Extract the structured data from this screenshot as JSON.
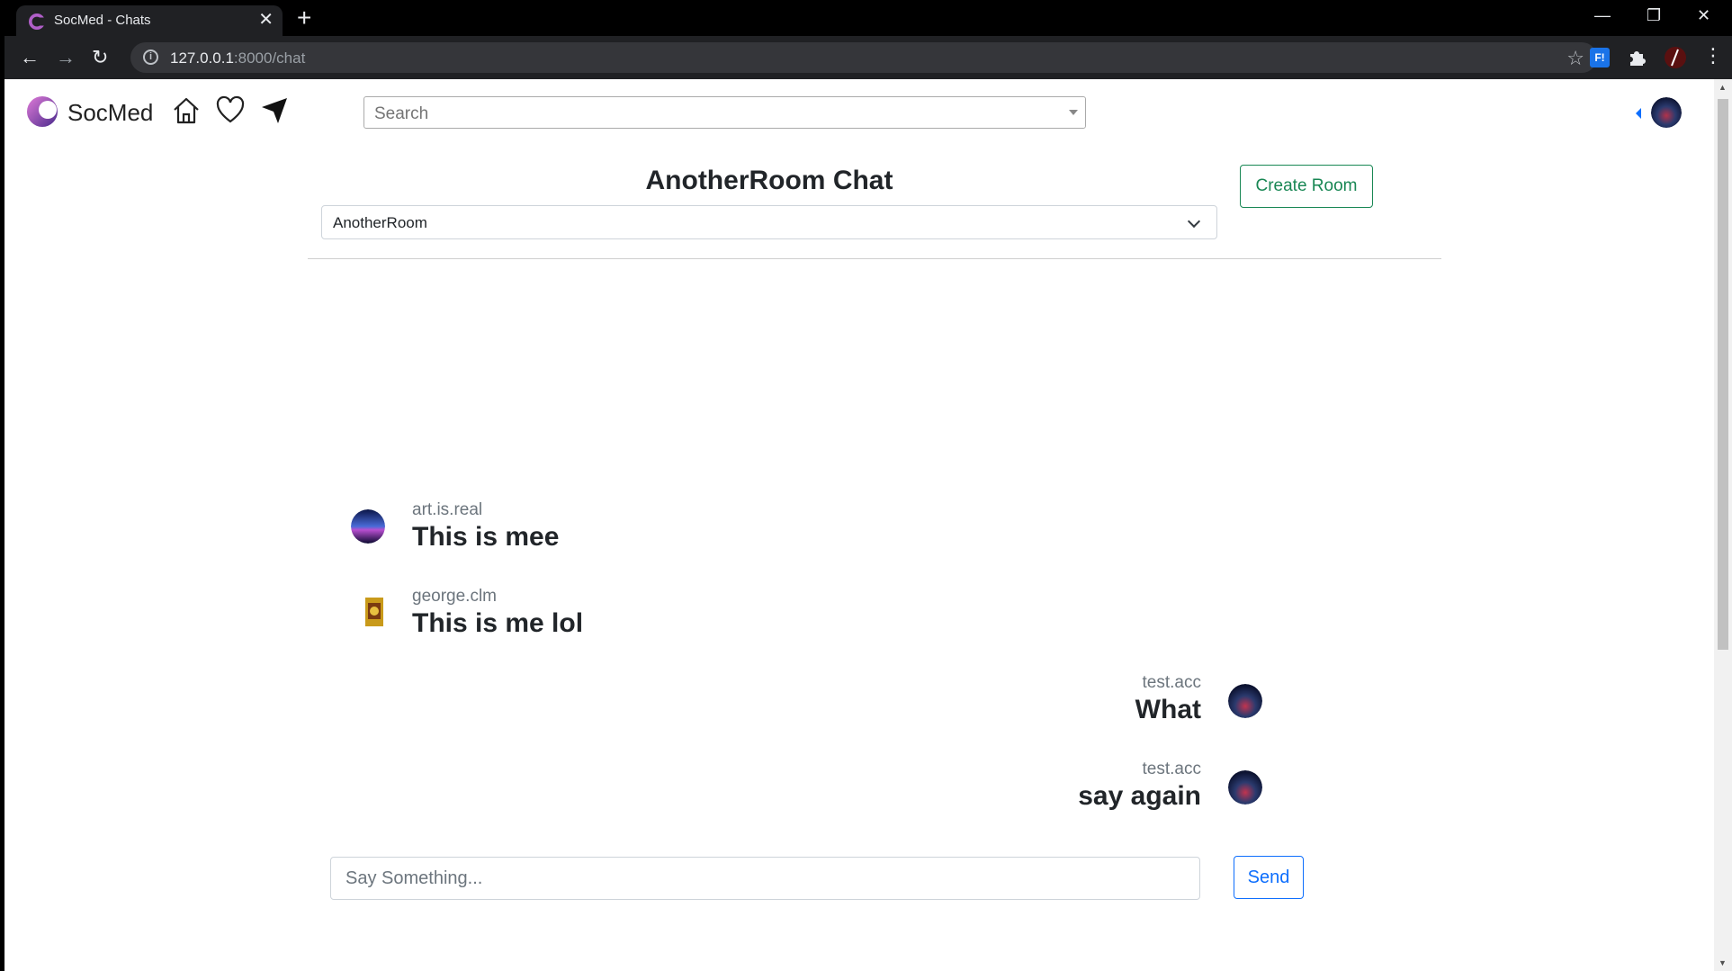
{
  "browser": {
    "tab_title": "SocMed - Chats",
    "tab_close": "✕",
    "new_tab": "+",
    "url_host": "127.0.0.1",
    "url_path": ":8000/chat",
    "controls": {
      "minimize": "—",
      "restore": "❐",
      "close": "✕"
    },
    "nav": {
      "back": "←",
      "forward": "→",
      "reload": "↻"
    },
    "star": "☆",
    "extension_badge": "F!"
  },
  "header": {
    "brand": "SocMed",
    "icons": [
      "home-icon",
      "heart-icon",
      "send-icon"
    ],
    "search_placeholder": "Search"
  },
  "chat": {
    "title": "AnotherRoom Chat",
    "selected_room": "AnotherRoom",
    "create_room_label": "Create Room",
    "messages": [
      {
        "user": "art.is.real",
        "text": "This is mee",
        "side": "left"
      },
      {
        "user": "george.clm",
        "text": "This is me lol",
        "side": "left"
      },
      {
        "user": "test.acc",
        "text": "What",
        "side": "right"
      },
      {
        "user": "test.acc",
        "text": "say again",
        "side": "right"
      }
    ],
    "input_placeholder": "Say Something...",
    "send_label": "Send"
  },
  "colors": {
    "create_room": "#198754",
    "send": "#0d6efd",
    "brand_logo": "#7b2d8e"
  }
}
